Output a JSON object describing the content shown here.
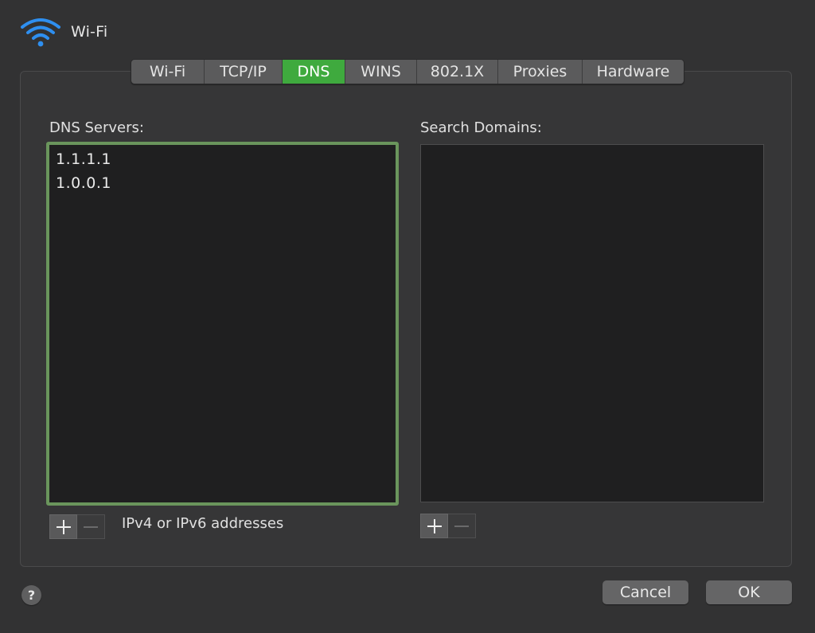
{
  "window": {
    "title": "Wi-Fi",
    "icon": "wifi-icon",
    "accent_color": "#3faa3e",
    "wifi_icon_color": "#2e8ff0"
  },
  "tabs": [
    {
      "label": "Wi-Fi",
      "active": false
    },
    {
      "label": "TCP/IP",
      "active": false
    },
    {
      "label": "DNS",
      "active": true
    },
    {
      "label": "WINS",
      "active": false
    },
    {
      "label": "802.1X",
      "active": false
    },
    {
      "label": "Proxies",
      "active": false
    },
    {
      "label": "Hardware",
      "active": false
    }
  ],
  "dns_servers": {
    "label": "DNS Servers:",
    "items": [
      "1.1.1.1",
      "1.0.0.1"
    ],
    "hint": "IPv4 or IPv6 addresses",
    "add_icon": "plus-icon",
    "remove_icon": "minus-icon"
  },
  "search_domains": {
    "label": "Search Domains:",
    "items": [],
    "add_icon": "plus-icon",
    "remove_icon": "minus-icon"
  },
  "footer": {
    "help_label": "?",
    "cancel_label": "Cancel",
    "ok_label": "OK"
  }
}
